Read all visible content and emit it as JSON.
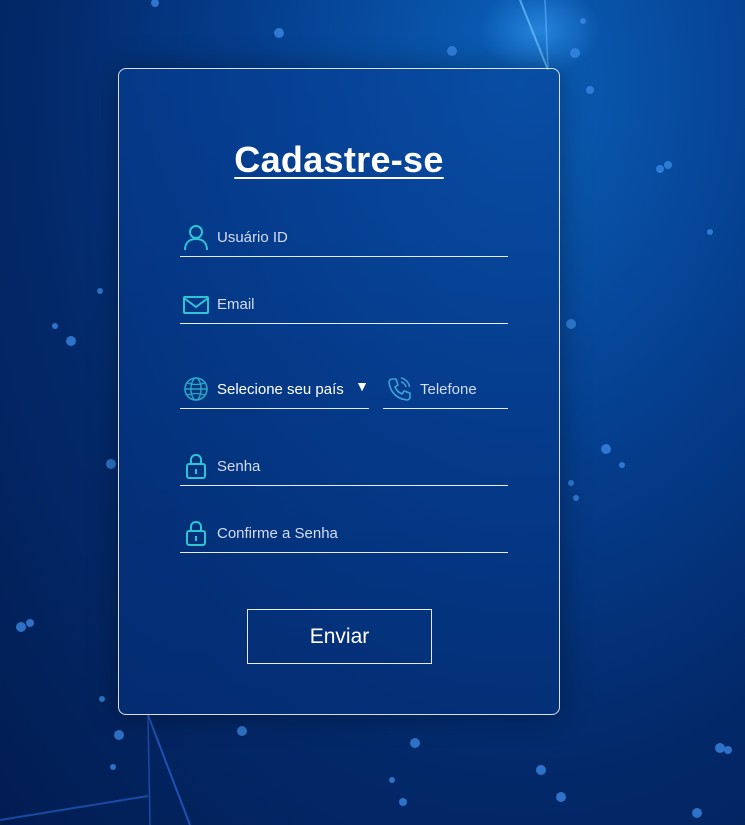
{
  "form": {
    "title": "Cadastre-se",
    "fields": {
      "user_id": {
        "placeholder": "Usuário ID",
        "icon": "user-icon"
      },
      "email": {
        "placeholder": "Email",
        "icon": "envelope-icon"
      },
      "country": {
        "selected": "Selecione seu país",
        "icon": "globe-icon",
        "caret": "▼"
      },
      "phone": {
        "placeholder": "Telefone",
        "icon": "phone-icon"
      },
      "password": {
        "placeholder": "Senha",
        "icon": "lock-icon"
      },
      "confirm_password": {
        "placeholder": "Confirme a Senha",
        "icon": "lock-icon"
      }
    },
    "submit_label": "Enviar"
  },
  "colors": {
    "accent_icon": "#2ec4d6",
    "text": "#ffffff",
    "background": "#03296a"
  }
}
